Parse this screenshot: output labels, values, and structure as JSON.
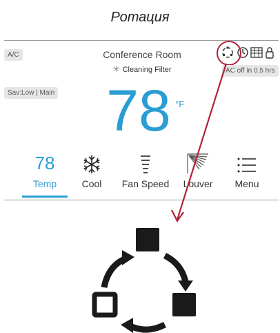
{
  "heading": "Ротация",
  "panel": {
    "mode_tag": "A/C",
    "fan_tag": "Sav:Low | Main",
    "room_name": "Conference Room",
    "filter_status": "Cleaning Filter",
    "temperature": "78",
    "unit": "°F",
    "timer_text": "AC off in 0.5 hrs",
    "status_icons": [
      "rotation-icon",
      "timer-icon",
      "schedule-grid-icon",
      "lock-icon"
    ]
  },
  "nav": {
    "items": [
      {
        "icon": "78",
        "label": "Temp"
      },
      {
        "icon": "snowflake-icon",
        "label": "Cool"
      },
      {
        "icon": "fan-speed-icon",
        "label": "Fan Speed"
      },
      {
        "icon": "louver-icon",
        "label": "Louver"
      },
      {
        "icon": "menu-icon",
        "label": "Menu"
      }
    ],
    "active_index": 0
  },
  "colors": {
    "accent": "#2a9ed4",
    "highlight": "#b0223a",
    "tag_bg": "#e6e6e6"
  }
}
